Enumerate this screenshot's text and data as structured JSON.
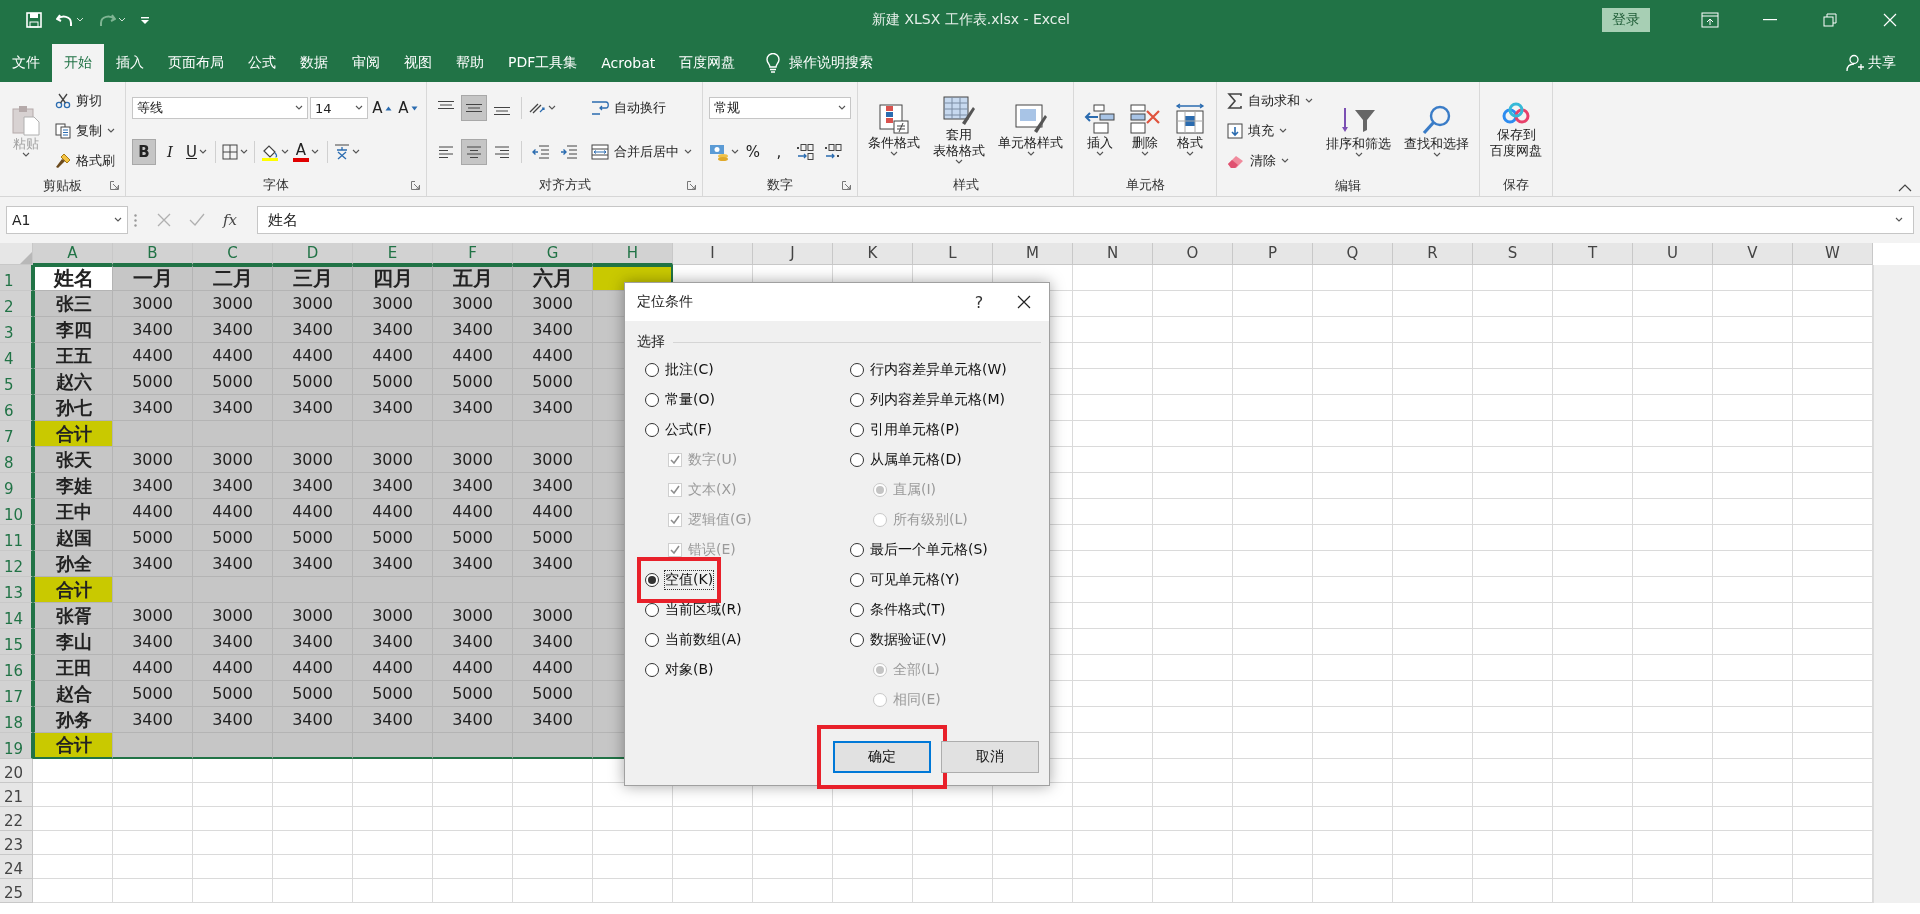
{
  "window": {
    "title": "新建 XLSX 工作表.xlsx  -  Excel",
    "sign_in": "登录"
  },
  "tabs": [
    {
      "label": "文件",
      "selected": false
    },
    {
      "label": "开始",
      "selected": true
    },
    {
      "label": "插入",
      "selected": false
    },
    {
      "label": "页面布局",
      "selected": false
    },
    {
      "label": "公式",
      "selected": false
    },
    {
      "label": "数据",
      "selected": false
    },
    {
      "label": "审阅",
      "selected": false
    },
    {
      "label": "视图",
      "selected": false
    },
    {
      "label": "帮助",
      "selected": false
    },
    {
      "label": "PDF工具集",
      "selected": false
    },
    {
      "label": "Acrobat",
      "selected": false
    },
    {
      "label": "百度网盘",
      "selected": false
    }
  ],
  "tell_me": "操作说明搜索",
  "share": "共享",
  "ribbon": [
    {
      "label": "剪贴板",
      "launcher": true,
      "columns": [
        [
          [
            {
              "kind": "large",
              "lines": [
                "粘贴"
              ],
              "dropdown": true,
              "disabled": true
            }
          ]
        ],
        [
          [
            {
              "kind": "small",
              "label": "剪切"
            }
          ],
          [
            {
              "kind": "small",
              "label": "复制",
              "dropdown": true
            }
          ],
          [
            {
              "kind": "small",
              "label": "格式刷"
            }
          ]
        ]
      ]
    },
    {
      "label": "字体",
      "launcher": true,
      "columns": [
        [
          [
            {
              "kind": "combo",
              "value": "等线"
            },
            {
              "kind": "combo",
              "value": "14"
            },
            {
              "kind": "letter",
              "text": "A",
              "selected": false
            },
            {
              "kind": "letter",
              "text": "A",
              "selected": false
            }
          ],
          [
            {
              "kind": "letter",
              "text": "B",
              "selected": true
            },
            {
              "kind": "letter",
              "text": "I",
              "selected": false
            },
            {
              "kind": "letter",
              "text": "U",
              "selected": false,
              "dropdown": true
            },
            {
              "kind": "sep"
            },
            {
              "kind": "icon",
              "selected": false,
              "dropdown": true
            },
            {
              "kind": "sep"
            },
            {
              "kind": "icon",
              "selected": false,
              "dropdown": true
            },
            {
              "kind": "letter",
              "text": "A",
              "selected": false,
              "dropdown": true
            },
            {
              "kind": "sep"
            },
            {
              "kind": "icon",
              "selected": false,
              "dropdown": true
            }
          ]
        ]
      ]
    },
    {
      "label": "对齐方式",
      "launcher": true,
      "columns": [
        [
          [
            {
              "kind": "icon",
              "selected": false
            },
            {
              "kind": "icon",
              "selected": true
            },
            {
              "kind": "icon",
              "selected": false
            },
            {
              "kind": "sep"
            },
            {
              "kind": "icon",
              "selected": false,
              "dropdown": true
            }
          ],
          [
            {
              "kind": "icon",
              "selected": false
            },
            {
              "kind": "icon",
              "selected": true
            },
            {
              "kind": "icon",
              "selected": false
            },
            {
              "kind": "sep"
            },
            {
              "kind": "icon",
              "selected": false
            },
            {
              "kind": "icon",
              "selected": false
            }
          ]
        ],
        [
          [
            {
              "kind": "small",
              "label": "自动换行"
            }
          ],
          [
            {
              "kind": "small",
              "label": "合并后居中",
              "dropdown": true
            }
          ]
        ]
      ]
    },
    {
      "label": "数字",
      "launcher": true,
      "columns": [
        [
          [
            {
              "kind": "combo",
              "value": "常规"
            }
          ],
          [
            {
              "kind": "icon",
              "selected": false,
              "dropdown": true
            },
            {
              "kind": "letter",
              "text": "%",
              "selected": false
            },
            {
              "kind": "letter",
              "text": ",",
              "selected": false
            },
            {
              "kind": "icon",
              "selected": false
            },
            {
              "kind": "icon",
              "selected": false
            }
          ]
        ]
      ]
    },
    {
      "label": "样式",
      "launcher": false,
      "columns": [
        [
          [
            {
              "kind": "large",
              "lines": [
                "条件格式"
              ],
              "dropdown": true
            }
          ]
        ],
        [
          [
            {
              "kind": "large",
              "lines": [
                "套用",
                "表格格式"
              ],
              "dropdown": true
            }
          ]
        ],
        [
          [
            {
              "kind": "large",
              "lines": [
                "单元格样式"
              ],
              "dropdown": true
            }
          ]
        ]
      ]
    },
    {
      "label": "单元格",
      "launcher": false,
      "columns": [
        [
          [
            {
              "kind": "large",
              "lines": [
                "插入"
              ],
              "dropdown": true
            }
          ]
        ],
        [
          [
            {
              "kind": "large",
              "lines": [
                "删除"
              ],
              "dropdown": true
            }
          ]
        ],
        [
          [
            {
              "kind": "large",
              "lines": [
                "格式"
              ],
              "dropdown": true
            }
          ]
        ]
      ]
    },
    {
      "label": "编辑",
      "launcher": false,
      "columns": [
        [
          [
            {
              "kind": "small",
              "label": "自动求和",
              "dropdown": true
            }
          ],
          [
            {
              "kind": "small",
              "label": "填充",
              "dropdown": true
            }
          ],
          [
            {
              "kind": "small",
              "label": "清除",
              "dropdown": true
            }
          ]
        ],
        [
          [
            {
              "kind": "large",
              "lines": [
                "排序和筛选"
              ],
              "dropdown": true
            }
          ]
        ],
        [
          [
            {
              "kind": "large",
              "lines": [
                "查找和选择"
              ],
              "dropdown": true
            }
          ]
        ]
      ]
    },
    {
      "label": "保存",
      "launcher": false,
      "columns": [
        [
          [
            {
              "kind": "large",
              "lines": [
                "保存到",
                "百度网盘"
              ]
            }
          ]
        ]
      ]
    }
  ],
  "formula_bar": {
    "name_box": "A1",
    "fx": "fx",
    "value": "姓名"
  },
  "sheet": {
    "columns": [
      {
        "label": "A",
        "selected": true
      },
      {
        "label": "B",
        "selected": true
      },
      {
        "label": "C",
        "selected": true
      },
      {
        "label": "D",
        "selected": true
      },
      {
        "label": "E",
        "selected": true
      },
      {
        "label": "F",
        "selected": true
      },
      {
        "label": "G",
        "selected": true
      },
      {
        "label": "H",
        "selected": true
      },
      {
        "label": "I",
        "selected": false
      },
      {
        "label": "J",
        "selected": false
      },
      {
        "label": "K",
        "selected": false
      },
      {
        "label": "L",
        "selected": false
      },
      {
        "label": "M",
        "selected": false
      },
      {
        "label": "N",
        "selected": false
      },
      {
        "label": "O",
        "selected": false
      },
      {
        "label": "P",
        "selected": false
      },
      {
        "label": "Q",
        "selected": false
      },
      {
        "label": "R",
        "selected": false
      },
      {
        "label": "S",
        "selected": false
      },
      {
        "label": "T",
        "selected": false
      },
      {
        "label": "U",
        "selected": false
      },
      {
        "label": "V",
        "selected": false
      },
      {
        "label": "W",
        "selected": false
      }
    ],
    "rows": [
      {
        "number": "1",
        "selected": true,
        "kind": "header",
        "cells": [
          "姓名",
          "一月",
          "二月",
          "三月",
          "四月",
          "五月",
          "六月"
        ]
      },
      {
        "number": "2",
        "selected": true,
        "kind": "data",
        "cells": [
          "张三",
          "3000",
          "3000",
          "3000",
          "3000",
          "3000",
          "3000"
        ]
      },
      {
        "number": "3",
        "selected": true,
        "kind": "data",
        "cells": [
          "李四",
          "3400",
          "3400",
          "3400",
          "3400",
          "3400",
          "3400"
        ]
      },
      {
        "number": "4",
        "selected": true,
        "kind": "data",
        "cells": [
          "王五",
          "4400",
          "4400",
          "4400",
          "4400",
          "4400",
          "4400"
        ]
      },
      {
        "number": "5",
        "selected": true,
        "kind": "data",
        "cells": [
          "赵六",
          "5000",
          "5000",
          "5000",
          "5000",
          "5000",
          "5000"
        ]
      },
      {
        "number": "6",
        "selected": true,
        "kind": "data",
        "cells": [
          "孙七",
          "3400",
          "3400",
          "3400",
          "3400",
          "3400",
          "3400"
        ]
      },
      {
        "number": "7",
        "selected": true,
        "kind": "total",
        "cells": [
          "合计"
        ]
      },
      {
        "number": "8",
        "selected": true,
        "kind": "data",
        "cells": [
          "张天",
          "3000",
          "3000",
          "3000",
          "3000",
          "3000",
          "3000"
        ]
      },
      {
        "number": "9",
        "selected": true,
        "kind": "data",
        "cells": [
          "李娃",
          "3400",
          "3400",
          "3400",
          "3400",
          "3400",
          "3400"
        ]
      },
      {
        "number": "10",
        "selected": true,
        "kind": "data",
        "cells": [
          "王中",
          "4400",
          "4400",
          "4400",
          "4400",
          "4400",
          "4400"
        ]
      },
      {
        "number": "11",
        "selected": true,
        "kind": "data",
        "cells": [
          "赵国",
          "5000",
          "5000",
          "5000",
          "5000",
          "5000",
          "5000"
        ]
      },
      {
        "number": "12",
        "selected": true,
        "kind": "data",
        "cells": [
          "孙全",
          "3400",
          "3400",
          "3400",
          "3400",
          "3400",
          "3400"
        ]
      },
      {
        "number": "13",
        "selected": true,
        "kind": "total",
        "cells": [
          "合计"
        ]
      },
      {
        "number": "14",
        "selected": true,
        "kind": "data",
        "cells": [
          "张胥",
          "3000",
          "3000",
          "3000",
          "3000",
          "3000",
          "3000"
        ]
      },
      {
        "number": "15",
        "selected": true,
        "kind": "data",
        "cells": [
          "李山",
          "3400",
          "3400",
          "3400",
          "3400",
          "3400",
          "3400"
        ]
      },
      {
        "number": "16",
        "selected": true,
        "kind": "data",
        "cells": [
          "王田",
          "4400",
          "4400",
          "4400",
          "4400",
          "4400",
          "4400"
        ]
      },
      {
        "number": "17",
        "selected": true,
        "kind": "data",
        "cells": [
          "赵合",
          "5000",
          "5000",
          "5000",
          "5000",
          "5000",
          "5000"
        ]
      },
      {
        "number": "18",
        "selected": true,
        "kind": "data",
        "cells": [
          "孙务",
          "3400",
          "3400",
          "3400",
          "3400",
          "3400",
          "3400"
        ]
      },
      {
        "number": "19",
        "selected": true,
        "kind": "total",
        "cells": [
          "合计"
        ]
      },
      {
        "number": "20",
        "selected": false,
        "kind": "empty"
      },
      {
        "number": "21",
        "selected": false,
        "kind": "empty"
      },
      {
        "number": "22",
        "selected": false,
        "kind": "empty"
      },
      {
        "number": "23",
        "selected": false,
        "kind": "empty"
      },
      {
        "number": "24",
        "selected": false,
        "kind": "empty"
      },
      {
        "number": "25",
        "selected": false,
        "kind": "empty"
      }
    ]
  },
  "dialog": {
    "title": "定位条件",
    "help": "?",
    "group": "选择",
    "left": [
      {
        "kind": "radio",
        "label": "批注(C)",
        "selected": false,
        "disabled": false,
        "highlighted": false
      },
      {
        "kind": "radio",
        "label": "常量(O)",
        "selected": false,
        "disabled": false,
        "highlighted": false
      },
      {
        "kind": "radio",
        "label": "公式(F)",
        "selected": false,
        "disabled": false,
        "highlighted": false,
        "children": [
          {
            "kind": "checkbox",
            "label": "数字(U)",
            "checked": true,
            "disabled": true
          },
          {
            "kind": "checkbox",
            "label": "文本(X)",
            "checked": true,
            "disabled": true
          },
          {
            "kind": "checkbox",
            "label": "逻辑值(G)",
            "checked": true,
            "disabled": true
          },
          {
            "kind": "checkbox",
            "label": "错误(E)",
            "checked": true,
            "disabled": true
          }
        ]
      },
      {
        "kind": "radio",
        "label": "空值(K)",
        "selected": true,
        "disabled": false,
        "highlighted": true
      },
      {
        "kind": "radio",
        "label": "当前区域(R)",
        "selected": false,
        "disabled": false,
        "highlighted": false
      },
      {
        "kind": "radio",
        "label": "当前数组(A)",
        "selected": false,
        "disabled": false,
        "highlighted": false
      },
      {
        "kind": "radio",
        "label": "对象(B)",
        "selected": false,
        "disabled": false,
        "highlighted": false
      }
    ],
    "right": [
      {
        "kind": "radio",
        "label": "行内容差异单元格(W)",
        "selected": false,
        "disabled": false,
        "highlighted": false
      },
      {
        "kind": "radio",
        "label": "列内容差异单元格(M)",
        "selected": false,
        "disabled": false,
        "highlighted": false
      },
      {
        "kind": "radio",
        "label": "引用单元格(P)",
        "selected": false,
        "disabled": false,
        "highlighted": false
      },
      {
        "kind": "radio",
        "label": "从属单元格(D)",
        "selected": false,
        "disabled": false,
        "highlighted": false,
        "children": [
          {
            "kind": "radio",
            "label": "直属(I)",
            "selected": true,
            "disabled": true
          },
          {
            "kind": "radio",
            "label": "所有级别(L)",
            "selected": false,
            "disabled": true
          }
        ]
      },
      {
        "kind": "radio",
        "label": "最后一个单元格(S)",
        "selected": false,
        "disabled": false,
        "highlighted": false
      },
      {
        "kind": "radio",
        "label": "可见单元格(Y)",
        "selected": false,
        "disabled": false,
        "highlighted": false
      },
      {
        "kind": "radio",
        "label": "条件格式(T)",
        "selected": false,
        "disabled": false,
        "highlighted": false
      },
      {
        "kind": "radio",
        "label": "数据验证(V)",
        "selected": false,
        "disabled": false,
        "highlighted": false,
        "children": [
          {
            "kind": "radio",
            "label": "全部(L)",
            "selected": true,
            "disabled": true
          },
          {
            "kind": "radio",
            "label": "相同(E)",
            "selected": false,
            "disabled": true
          }
        ]
      }
    ],
    "buttons": [
      {
        "label": "确定",
        "default": true,
        "highlighted": true
      },
      {
        "label": "取消",
        "default": false,
        "highlighted": false
      }
    ]
  }
}
